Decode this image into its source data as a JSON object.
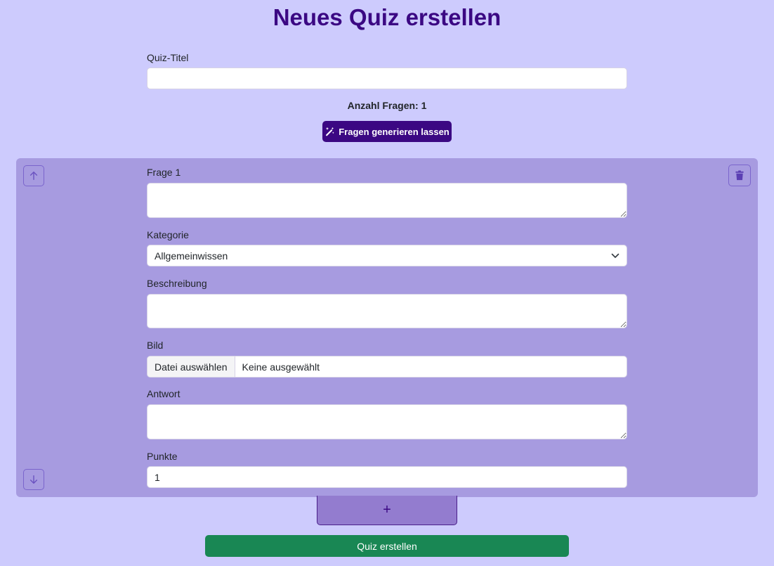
{
  "header": {
    "title": "Neues Quiz erstellen"
  },
  "quiz": {
    "title_label": "Quiz-Titel",
    "title_value": "",
    "count_text": "Anzahl Fragen: 1",
    "generate_label": "Fragen generieren lassen"
  },
  "question": {
    "label": "Frage 1",
    "value": "",
    "category_label": "Kategorie",
    "category_value": "Allgemeinwissen",
    "description_label": "Beschreibung",
    "description_value": "",
    "image_label": "Bild",
    "file_button_label": "Datei auswählen",
    "file_status": "Keine ausgewählt",
    "answer_label": "Antwort",
    "answer_value": "",
    "points_label": "Punkte",
    "points_value": "1"
  },
  "actions": {
    "add_label": "+",
    "submit_label": "Quiz erstellen"
  },
  "icons": {
    "generate": "magic-wand-icon",
    "move_up": "arrow-up-icon",
    "move_down": "arrow-down-icon",
    "delete": "trash-icon",
    "dropdown": "chevron-down-icon"
  },
  "colors": {
    "background": "#cdcbfd",
    "title": "#3b0883",
    "card": "#a79be0",
    "primary_button": "#3b0883",
    "submit_button": "#198754",
    "add_button": "#937ccf"
  }
}
